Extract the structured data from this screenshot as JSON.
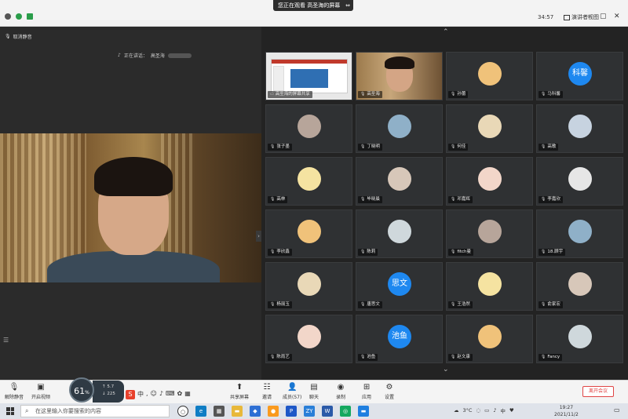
{
  "titlebar": {
    "share_banner": "您正在观看 高圣海的屏幕",
    "stop_icon": "stop-share-icon",
    "timer": "34:57",
    "view_mode": "演讲者视图"
  },
  "main": {
    "mute_label": "取消静音",
    "speaking_prefix": "正在讲话：",
    "speaking_name": "高圣海"
  },
  "gallery": {
    "participants": [
      {
        "name": "高圣海的屏幕共享",
        "type": "screen"
      },
      {
        "name": "高圣海",
        "type": "camera"
      },
      {
        "name": "孙蕾",
        "type": "avatar"
      },
      {
        "name": "马科馨",
        "type": "text",
        "avatar_text": "科馨"
      },
      {
        "name": "张子墨",
        "type": "avatar"
      },
      {
        "name": "丁晓明",
        "type": "avatar"
      },
      {
        "name": "何佳",
        "type": "avatar"
      },
      {
        "name": "高歌",
        "type": "avatar"
      },
      {
        "name": "高林",
        "type": "avatar"
      },
      {
        "name": "毕晓晨",
        "type": "avatar"
      },
      {
        "name": "邓嘉辉",
        "type": "avatar"
      },
      {
        "name": "李嘉欣",
        "type": "avatar"
      },
      {
        "name": "李欣鑫",
        "type": "avatar"
      },
      {
        "name": "陈莉",
        "type": "avatar"
      },
      {
        "name": "fitch曼",
        "type": "avatar"
      },
      {
        "name": "18.顾宇",
        "type": "avatar"
      },
      {
        "name": "杨丽玉",
        "type": "avatar"
      },
      {
        "name": "唐思文",
        "type": "text",
        "avatar_text": "思文"
      },
      {
        "name": "王浩然",
        "type": "avatar"
      },
      {
        "name": "俞家宏",
        "type": "avatar"
      },
      {
        "name": "陈雨艺",
        "type": "avatar"
      },
      {
        "name": "池鱼",
        "type": "text",
        "avatar_text": "池鱼"
      },
      {
        "name": "赵文康",
        "type": "avatar"
      },
      {
        "name": "Fancy",
        "type": "avatar"
      }
    ]
  },
  "toolbar": {
    "mute": "解除静音",
    "video": "开启视频",
    "network_value": "61",
    "network_unit": "%",
    "upload": "5.7",
    "download": "225",
    "share": "共享屏幕",
    "security": "邀请",
    "members": "成员(57)",
    "chat": "聊天",
    "record": "录制",
    "apps": "应用",
    "settings": "设置",
    "end": "离开会议",
    "ime": "中"
  },
  "taskbar": {
    "search_placeholder": "在这里输入你要搜索的内容",
    "temperature": "3°C",
    "ime": "中",
    "time": "19:27",
    "date": "2021/11/2"
  },
  "colors": {
    "accent_blue": "#1e88f0",
    "end_red": "#e04545",
    "gallery_bg": "#232323"
  }
}
